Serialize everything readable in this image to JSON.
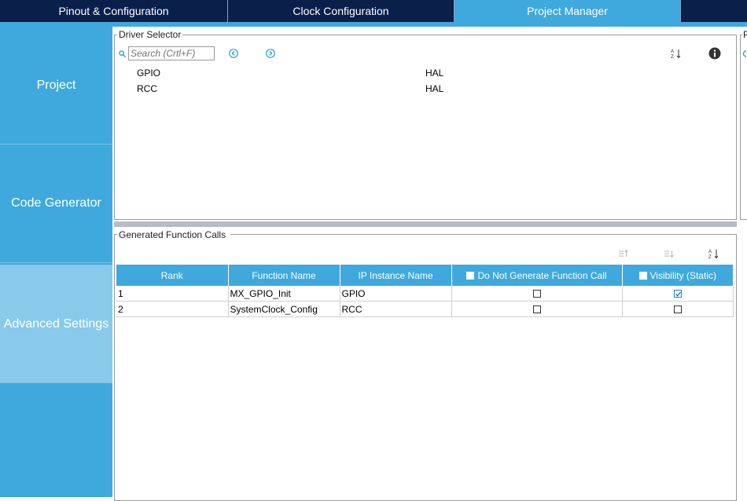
{
  "tabs": [
    {
      "label": "Pinout & Configuration"
    },
    {
      "label": "Clock Configuration"
    },
    {
      "label": "Project Manager",
      "active": true
    }
  ],
  "sidebar": {
    "items": [
      {
        "label": "Project"
      },
      {
        "label": "Code Generator"
      },
      {
        "label": "Advanced Settings",
        "active": true
      }
    ]
  },
  "driver_selector": {
    "title": "Driver Selector",
    "search_placeholder": "Search (Crtl+F)",
    "rows": [
      {
        "name": "GPIO",
        "driver": "HAL"
      },
      {
        "name": "RCC",
        "driver": "HAL"
      }
    ]
  },
  "generated_calls": {
    "title": "Generated Function Calls",
    "columns": [
      "Rank",
      "Function Name",
      "IP Instance Name",
      "Do Not Generate Function Call",
      "Visibility (Static)"
    ],
    "rows": [
      {
        "rank": "1",
        "function": "MX_GPIO_Init",
        "instance": "GPIO",
        "do_not_generate": false,
        "visibility_static": true
      },
      {
        "rank": "2",
        "function": "SystemClock_Config",
        "instance": "RCC",
        "do_not_generate": false,
        "visibility_static": false
      }
    ]
  },
  "right_panel": {
    "partial_label": "P"
  },
  "colors": {
    "tab_bar": "#0a1f4a",
    "accent": "#3fa9dd",
    "sidebar_active": "#89c9ea",
    "icon_blue": "#2a9fd8"
  },
  "icons": {
    "search": "search-icon",
    "prev": "chevron-left-circle-icon",
    "next": "chevron-right-circle-icon",
    "sort": "sort-az-icon",
    "info": "info-icon",
    "move_up": "move-up-icon",
    "move_down": "move-down-icon"
  }
}
